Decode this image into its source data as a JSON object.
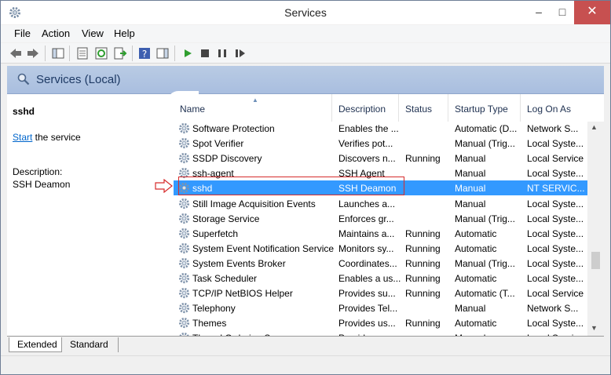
{
  "window": {
    "title": "Services"
  },
  "menu": {
    "file": "File",
    "action": "Action",
    "view": "View",
    "help": "Help"
  },
  "header": {
    "title": "Services (Local)"
  },
  "left_pane": {
    "service_name": "sshd",
    "start_link": "Start",
    "start_suffix": " the service",
    "description_label": "Description:",
    "description_value": "SSH Deamon"
  },
  "columns": {
    "name": "Name",
    "description": "Description",
    "status": "Status",
    "startup_type": "Startup Type",
    "log_on_as": "Log On As"
  },
  "services": [
    {
      "name": "Software Protection",
      "description": "Enables the ...",
      "status": "",
      "startup": "Automatic (D...",
      "logon": "Network S..."
    },
    {
      "name": "Spot Verifier",
      "description": "Verifies pot...",
      "status": "",
      "startup": "Manual (Trig...",
      "logon": "Local Syste..."
    },
    {
      "name": "SSDP Discovery",
      "description": "Discovers n...",
      "status": "Running",
      "startup": "Manual",
      "logon": "Local Service"
    },
    {
      "name": "ssh-agent",
      "description": "SSH Agent",
      "status": "",
      "startup": "Manual",
      "logon": "Local Syste..."
    },
    {
      "name": "sshd",
      "description": "SSH Deamon",
      "status": "",
      "startup": "Manual",
      "logon": "NT SERVIC..."
    },
    {
      "name": "Still Image Acquisition Events",
      "description": "Launches a...",
      "status": "",
      "startup": "Manual",
      "logon": "Local Syste..."
    },
    {
      "name": "Storage Service",
      "description": "Enforces gr...",
      "status": "",
      "startup": "Manual (Trig...",
      "logon": "Local Syste..."
    },
    {
      "name": "Superfetch",
      "description": "Maintains a...",
      "status": "Running",
      "startup": "Automatic",
      "logon": "Local Syste..."
    },
    {
      "name": "System Event Notification Service",
      "description": "Monitors sy...",
      "status": "Running",
      "startup": "Automatic",
      "logon": "Local Syste..."
    },
    {
      "name": "System Events Broker",
      "description": "Coordinates...",
      "status": "Running",
      "startup": "Manual (Trig...",
      "logon": "Local Syste..."
    },
    {
      "name": "Task Scheduler",
      "description": "Enables a us...",
      "status": "Running",
      "startup": "Automatic",
      "logon": "Local Syste..."
    },
    {
      "name": "TCP/IP NetBIOS Helper",
      "description": "Provides su...",
      "status": "Running",
      "startup": "Automatic (T...",
      "logon": "Local Service"
    },
    {
      "name": "Telephony",
      "description": "Provides Tel...",
      "status": "",
      "startup": "Manual",
      "logon": "Network S..."
    },
    {
      "name": "Themes",
      "description": "Provides us...",
      "status": "Running",
      "startup": "Automatic",
      "logon": "Local Syste..."
    },
    {
      "name": "Thread Ordering Server",
      "description": "Provides or...",
      "status": "",
      "startup": "Manual",
      "logon": "Local Service"
    }
  ],
  "selected_index": 4,
  "tabs": {
    "extended": "Extended",
    "standard": "Standard"
  },
  "colors": {
    "selection": "#3399ff",
    "header_band": "#a9bedf",
    "highlight_box": "#d62b2b",
    "close_button": "#c75050"
  }
}
